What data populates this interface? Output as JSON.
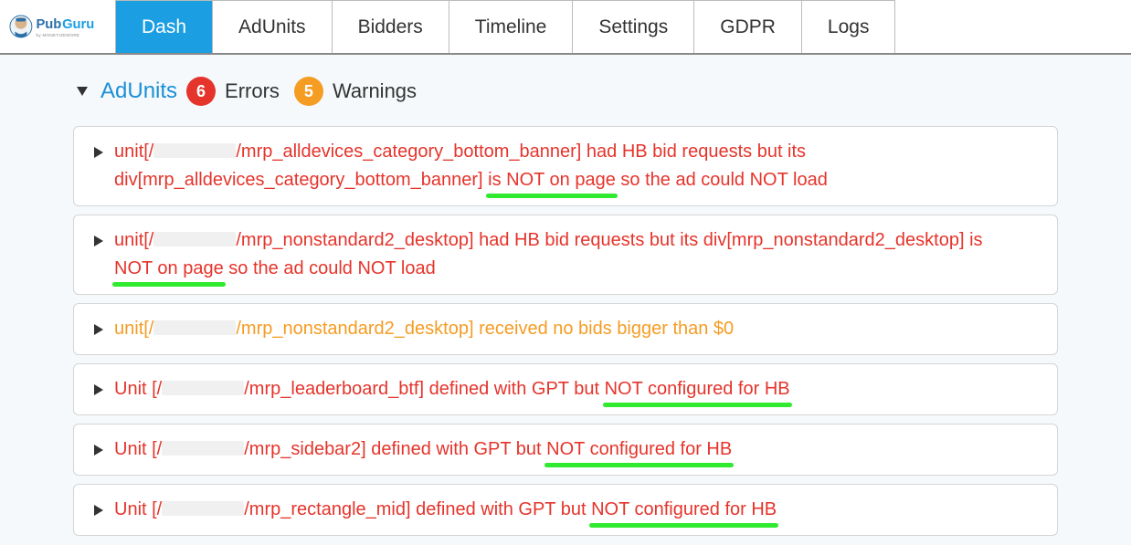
{
  "nav": {
    "items": [
      {
        "label": "Dash",
        "active": true
      },
      {
        "label": "AdUnits",
        "active": false
      },
      {
        "label": "Bidders",
        "active": false
      },
      {
        "label": "Timeline",
        "active": false
      },
      {
        "label": "Settings",
        "active": false
      },
      {
        "label": "GDPR",
        "active": false
      },
      {
        "label": "Logs",
        "active": false
      }
    ]
  },
  "brand": {
    "name": "PubGuru",
    "subtitle": "by MONETIZEMORE"
  },
  "section": {
    "title": "AdUnits",
    "error_count": "6",
    "error_label": "Errors",
    "warning_count": "5",
    "warning_label": "Warnings"
  },
  "rows": [
    {
      "severity": "error",
      "pre1": "unit[/",
      "redact1_w": 90,
      "mid1": "/mrp_alldevices_category_bottom_banner] had HB bid requests but its div[mrp_alldevices_category_bottom_banner] ",
      "hl1": "is NOT on page",
      "post1": " so the ad could NOT load"
    },
    {
      "severity": "error",
      "pre1": "unit[/",
      "redact1_w": 90,
      "mid1": "/mrp_nonstandard2_desktop] had HB bid requests but its div[mrp_nonstandard2_desktop] is ",
      "hl1": "NOT on page",
      "post1": " so the ad could NOT load"
    },
    {
      "severity": "warning",
      "pre1": "unit[/",
      "redact1_w": 90,
      "mid1": "/mrp_nonstandard2_desktop] received no bids bigger than $0",
      "hl1": "",
      "post1": ""
    },
    {
      "severity": "error",
      "pre1": "Unit [/",
      "redact1_w": 90,
      "mid1": "/mrp_leaderboard_btf] defined with GPT but ",
      "hl1": "NOT configured for HB",
      "post1": ""
    },
    {
      "severity": "error",
      "pre1": "Unit [/",
      "redact1_w": 90,
      "mid1": "/mrp_sidebar2] defined with GPT but ",
      "hl1": "NOT configured for HB",
      "post1": ""
    },
    {
      "severity": "error",
      "pre1": "Unit [/",
      "redact1_w": 90,
      "mid1": "/mrp_rectangle_mid] defined with GPT but ",
      "hl1": "NOT configured for HB",
      "post1": ""
    }
  ]
}
